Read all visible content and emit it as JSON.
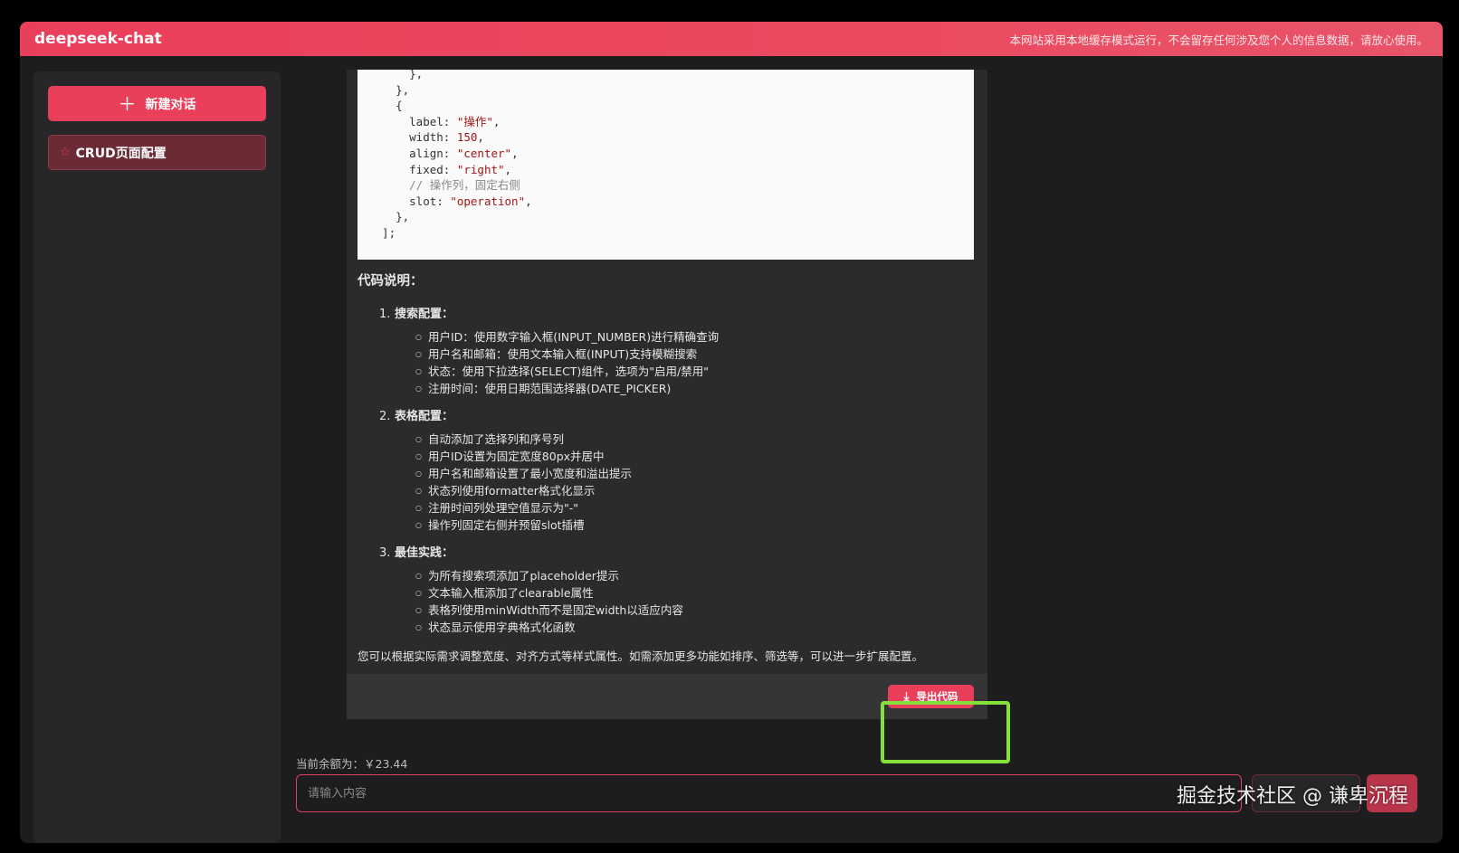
{
  "header": {
    "brand": "deepseek-chat",
    "notice": "本网站采用本地缓存模式运行，不会留存任何涉及您个人的信息数据，请放心使用。"
  },
  "sidebar": {
    "new_chat_label": "新建对话",
    "conversations": [
      {
        "title": "CRUD页面配置"
      }
    ]
  },
  "code": {
    "lines": [
      [
        {
          "t": "      },",
          "c": ""
        }
      ],
      [
        {
          "t": "    },",
          "c": ""
        }
      ],
      [
        {
          "t": "    {",
          "c": ""
        }
      ],
      [
        {
          "t": "      label: ",
          "c": ""
        },
        {
          "t": "\"操作\"",
          "c": "str"
        },
        {
          "t": ",",
          "c": ""
        }
      ],
      [
        {
          "t": "      width: ",
          "c": ""
        },
        {
          "t": "150",
          "c": "num"
        },
        {
          "t": ",",
          "c": ""
        }
      ],
      [
        {
          "t": "      align: ",
          "c": ""
        },
        {
          "t": "\"center\"",
          "c": "str"
        },
        {
          "t": ",",
          "c": ""
        }
      ],
      [
        {
          "t": "      fixed: ",
          "c": ""
        },
        {
          "t": "\"right\"",
          "c": "str"
        },
        {
          "t": ",",
          "c": ""
        }
      ],
      [
        {
          "t": "      // 操作列，固定右侧",
          "c": "com"
        }
      ],
      [
        {
          "t": "      slot: ",
          "c": ""
        },
        {
          "t": "\"operation\"",
          "c": "str"
        },
        {
          "t": ",",
          "c": ""
        }
      ],
      [
        {
          "t": "    },",
          "c": ""
        }
      ],
      [
        {
          "t": "  ];",
          "c": ""
        }
      ]
    ]
  },
  "explanation": {
    "heading": "代码说明：",
    "sections": [
      {
        "num": "1.",
        "title": "搜索配置",
        "items": [
          "用户ID：使用数字输入框(INPUT_NUMBER)进行精确查询",
          "用户名和邮箱：使用文本输入框(INPUT)支持模糊搜索",
          "状态：使用下拉选择(SELECT)组件，选项为\"启用/禁用\"",
          "注册时间：使用日期范围选择器(DATE_PICKER)"
        ]
      },
      {
        "num": "2.",
        "title": "表格配置",
        "items": [
          "自动添加了选择列和序号列",
          "用户ID设置为固定宽度80px并居中",
          "用户名和邮箱设置了最小宽度和溢出提示",
          "状态列使用formatter格式化显示",
          "注册时间列处理空值显示为\"-\"",
          "操作列固定右侧并预留slot插槽"
        ]
      },
      {
        "num": "3.",
        "title": "最佳实践",
        "items": [
          "为所有搜索项添加了placeholder提示",
          "文本输入框添加了clearable属性",
          "表格列使用minWidth而不是固定width以适应内容",
          "状态显示使用字典格式化函数"
        ]
      }
    ],
    "closing": "您可以根据实际需求调整宽度、对齐方式等样式属性。如需添加更多功能如排序、筛选等，可以进一步扩展配置。"
  },
  "export": {
    "label": "导出代码"
  },
  "balance": {
    "text": "当前余额为：￥23.44"
  },
  "input": {
    "placeholder": "请输入内容"
  },
  "watermark": {
    "text": "掘金技术社区 @ 谦卑沉程"
  },
  "colors": {
    "accent": "#ea3f5b",
    "highlight": "#86e03b",
    "background": "#1d1d1f"
  }
}
